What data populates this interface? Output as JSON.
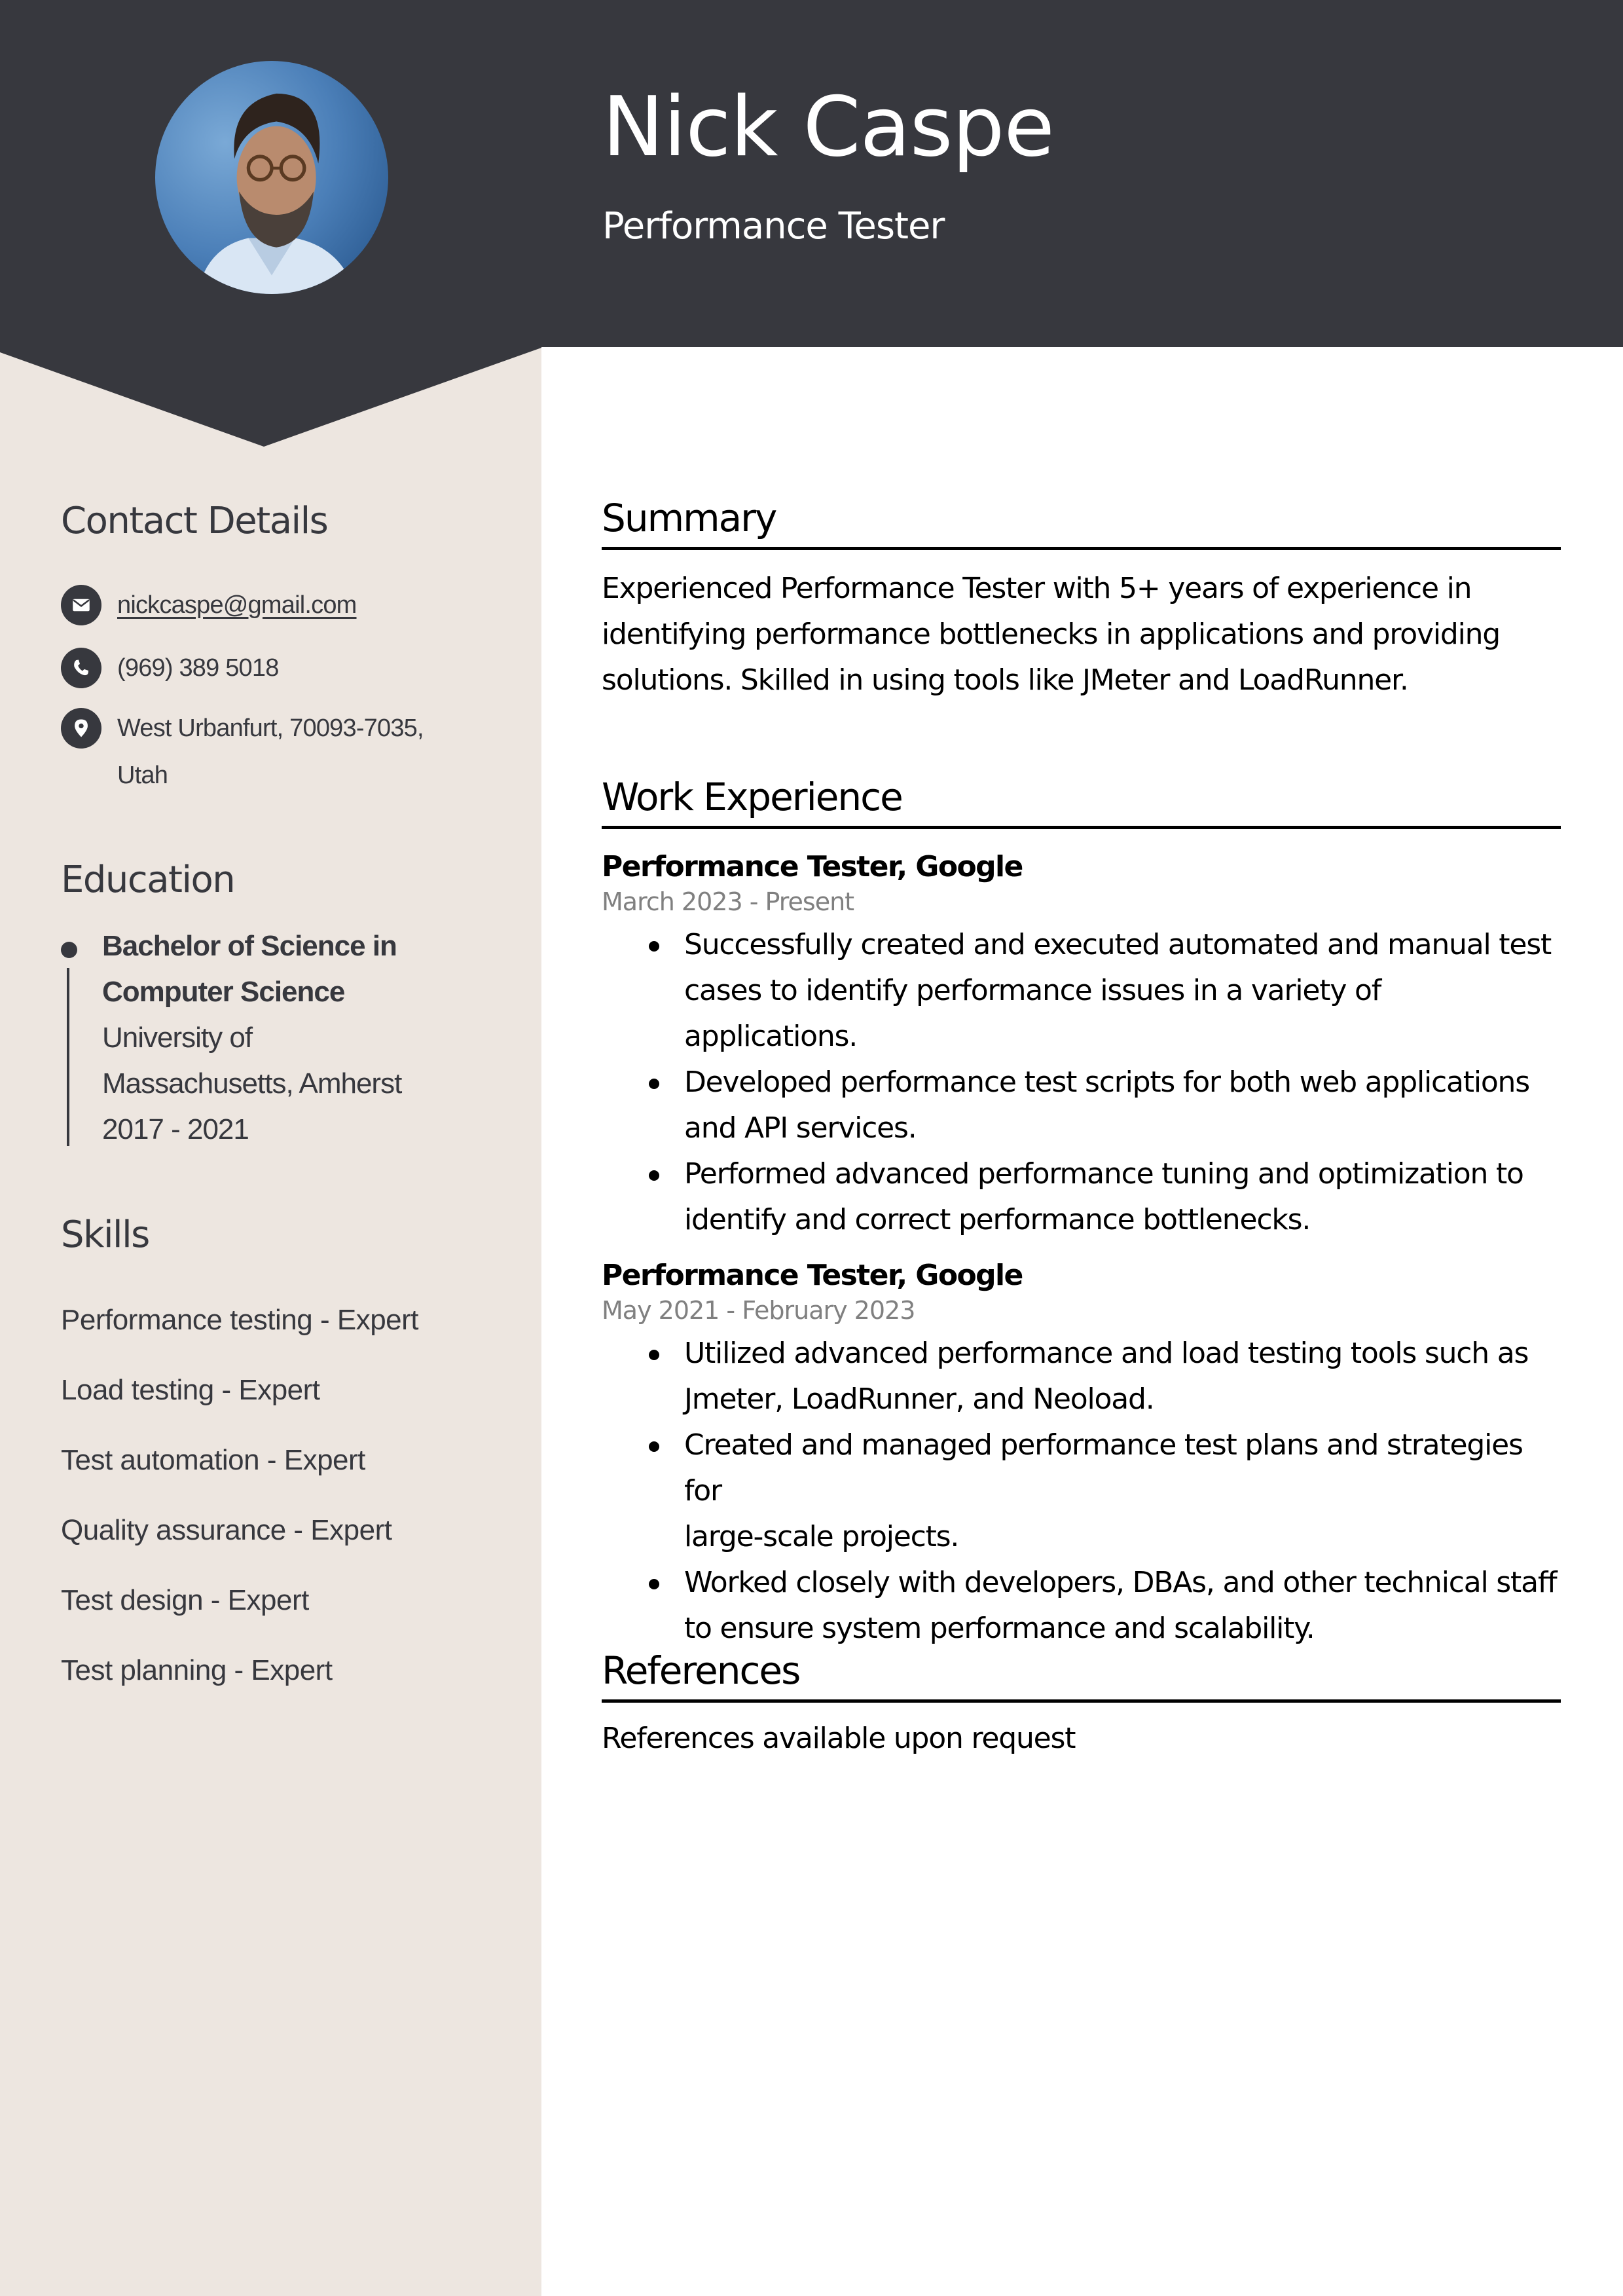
{
  "colors": {
    "header_bg": "#37383e",
    "sidebar_bg": "#ede6e0",
    "sidebar_text": "#37383e",
    "main_text": "#000000",
    "date_text": "#808080"
  },
  "header": {
    "name": "Nick Caspe",
    "title": "Performance Tester",
    "avatar": "profile-photo"
  },
  "sidebar": {
    "contact": {
      "heading": "Contact Details",
      "items": [
        {
          "icon": "email-icon",
          "text": "nickcaspe@gmail.com"
        },
        {
          "icon": "phone-icon",
          "text": "(969) 389 5018"
        },
        {
          "icon": "location-pin-icon",
          "text": "West Urbanfurt, 70093-7035,",
          "text2": "Utah"
        }
      ]
    },
    "education": {
      "heading": "Education",
      "items": [
        {
          "degree_line1": "Bachelor of Science in",
          "degree_line2": "Computer Science",
          "school_line1": "University of",
          "school_line2": "Massachusetts, Amherst",
          "years": "2017 - 2021"
        }
      ]
    },
    "skills": {
      "heading": "Skills",
      "items": [
        "Performance testing - Expert",
        "Load testing - Expert",
        "Test automation - Expert",
        "Quality assurance - Expert",
        "Test design - Expert",
        "Test planning - Expert"
      ]
    }
  },
  "main": {
    "summary": {
      "heading": "Summary",
      "lines": [
        "Experienced Performance Tester with 5+ years of experience in",
        "identifying performance bottlenecks in applications and providing",
        "solutions. Skilled in using tools like JMeter and LoadRunner."
      ]
    },
    "experience": {
      "heading": "Work Experience",
      "jobs": [
        {
          "title": "Performance Tester, Google",
          "dates": "March 2023 - Present",
          "bullets": [
            [
              "Successfully created and executed automated and manual test",
              "cases to identify performance issues in a variety of applications."
            ],
            [
              "Developed performance test scripts for both web applications",
              "and API services."
            ],
            [
              "Performed advanced performance tuning and optimization to",
              "identify and correct performance bottlenecks."
            ]
          ]
        },
        {
          "title": "Performance Tester, Google",
          "dates": "May 2021 - February 2023",
          "bullets": [
            [
              "Utilized advanced performance and load testing tools such as",
              "Jmeter, LoadRunner, and Neoload."
            ],
            [
              "Created and managed performance test plans and strategies for",
              "large-scale projects."
            ],
            [
              "Worked closely with developers, DBAs, and other technical staff",
              "to ensure system performance and scalability."
            ]
          ]
        }
      ]
    },
    "references": {
      "heading": "References",
      "text": "References available upon request"
    }
  }
}
